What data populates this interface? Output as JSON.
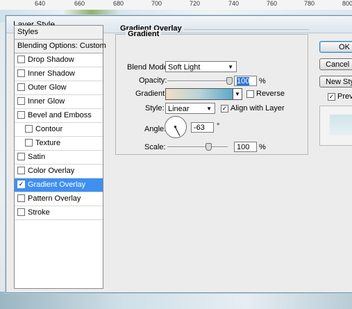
{
  "ruler": {
    "labels": [
      "640",
      "660",
      "680",
      "700",
      "720",
      "740",
      "760",
      "780",
      "800"
    ]
  },
  "dialog": {
    "title": "Layer Style",
    "styles": [
      {
        "label": "Styles",
        "kind": "header"
      },
      {
        "label": "Blending Options: Custom",
        "kind": "header"
      },
      {
        "label": "Drop Shadow",
        "checked": false
      },
      {
        "label": "Inner Shadow",
        "checked": false
      },
      {
        "label": "Outer Glow",
        "checked": false
      },
      {
        "label": "Inner Glow",
        "checked": false
      },
      {
        "label": "Bevel and Emboss",
        "checked": false
      },
      {
        "label": "Contour",
        "checked": false,
        "indent": true
      },
      {
        "label": "Texture",
        "checked": false,
        "indent": true
      },
      {
        "label": "Satin",
        "checked": false
      },
      {
        "label": "Color Overlay",
        "checked": false
      },
      {
        "label": "Gradient Overlay",
        "checked": true,
        "selected": true
      },
      {
        "label": "Pattern Overlay",
        "checked": false
      },
      {
        "label": "Stroke",
        "checked": false
      }
    ],
    "panel": {
      "group_title": "Gradient Overlay",
      "section_title": "Gradient",
      "blend_mode_label": "Blend Mode:",
      "blend_mode_value": "Soft Light",
      "opacity_label": "Opacity:",
      "opacity_value": "100",
      "opacity_percent": 100,
      "percent_sign": "%",
      "gradient_label": "Gradient:",
      "reverse_label": "Reverse",
      "reverse_checked": false,
      "style_label": "Style:",
      "style_value": "Linear",
      "align_label": "Align with Layer",
      "align_checked": true,
      "angle_label": "Angle:",
      "angle_value": "-63",
      "degree_sign": "°",
      "scale_label": "Scale:",
      "scale_value": "100",
      "scale_percent": 100
    },
    "buttons": {
      "ok": "OK",
      "cancel": "Cancel",
      "new_style": "New Style...",
      "preview": "Preview",
      "preview_checked": true
    }
  }
}
